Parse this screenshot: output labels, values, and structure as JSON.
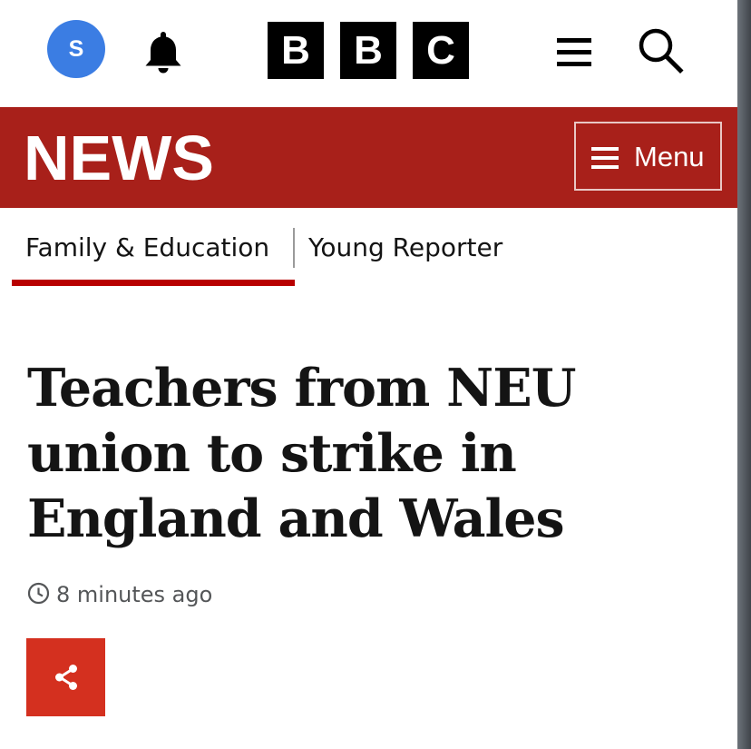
{
  "header": {
    "avatar_initial": "S",
    "logo_letters": [
      "B",
      "B",
      "C"
    ],
    "icons": {
      "notifications": "bell-icon",
      "menu": "hamburger-icon",
      "search": "search-icon"
    }
  },
  "news_bar": {
    "wordmark": "NEWS",
    "menu_label": "Menu"
  },
  "section_nav": {
    "tabs": [
      {
        "label": "Family & Education",
        "active": true
      },
      {
        "label": "Young Reporter",
        "active": false
      }
    ]
  },
  "article": {
    "headline": "Teachers from NEU union to strike in England and Wales",
    "timestamp": "8 minutes ago"
  },
  "colors": {
    "news_red": "#a8201a",
    "share_red": "#d4301f",
    "avatar_blue": "#3b7de3",
    "active_tab_underline": "#b80000"
  }
}
